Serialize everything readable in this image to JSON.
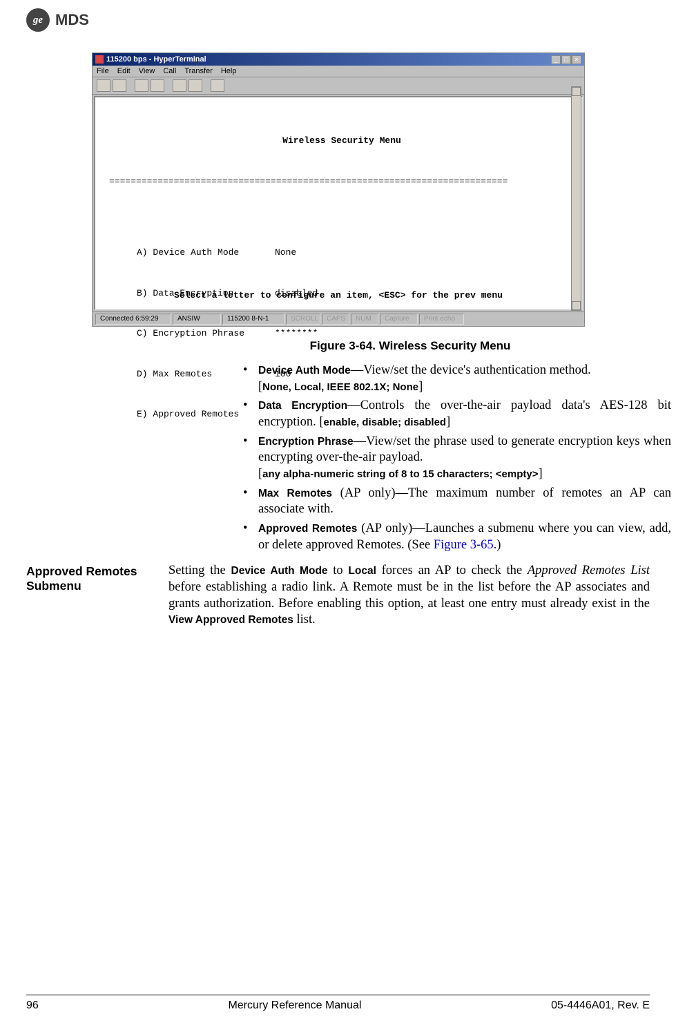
{
  "logo": {
    "ge": "ge",
    "mds": "MDS"
  },
  "screenshot": {
    "title": "115200 bps - HyperTerminal",
    "menubar": [
      "File",
      "Edit",
      "View",
      "Call",
      "Transfer",
      "Help"
    ],
    "terminal_title": "Wireless Security Menu",
    "items": [
      {
        "key": "A) Device Auth Mode",
        "val": "None"
      },
      {
        "key": "B) Data Encryption",
        "val": "disabled"
      },
      {
        "key": "C) Encryption Phrase",
        "val": "********"
      },
      {
        "key": "D) Max Remotes",
        "val": "100"
      },
      {
        "key": "E) Approved Remotes",
        "val": ""
      }
    ],
    "footer": "Select a letter to configure an item, <ESC> for the prev menu",
    "status": {
      "conn": "Connected 6:59:29",
      "term": "ANSIW",
      "baud": "115200 8-N-1",
      "fields": [
        "SCROLL",
        "CAPS",
        "NUM",
        "Capture",
        "Print echo"
      ]
    }
  },
  "caption": "Figure 3-64. Wireless Security Menu",
  "bullets": {
    "b1": {
      "label": "Device Auth Mode",
      "text": "—View/set the device's authentication method.",
      "opt": "None, Local, IEEE 802.1X; None"
    },
    "b2": {
      "label": "Data Encryption",
      "text1": "—Controls the over-the-air payload data's AES-128 bit encryption. [",
      "opt": "enable, disable; disabled",
      "text2": "]"
    },
    "b3": {
      "label": "Encryption Phrase",
      "text": "—View/set the phrase used to generate encryption keys when encrypting over-the-air payload.",
      "opt": "any alpha-numeric string of 8 to 15 characters; <empty>"
    },
    "b4": {
      "label": "Max Remotes",
      "suffix": " (AP only)—The maximum number of remotes an AP can associate with."
    },
    "b5": {
      "label": "Approved Remotes",
      "suffix": " (AP only)—Launches a submenu where you can view, add, or delete approved Remotes. (See ",
      "link": "Figure 3-65",
      "end": ".)"
    }
  },
  "side": {
    "heading": "Approved Remotes Submenu",
    "p1a": "Setting the ",
    "p1b": "Device Auth Mode",
    "p1c": " to ",
    "p1d": "Local",
    "p1e": " forces an AP to check the ",
    "p1f": "Approved Remotes List",
    "p1g": " before establishing a radio link. A Remote must be in the list before the AP associates and grants authorization. Before enabling this option, at least one entry must already exist in the ",
    "p1h": "View Approved Remotes",
    "p1i": " list."
  },
  "footer": {
    "page": "96",
    "title": "Mercury Reference Manual",
    "doc": "05-4446A01, Rev. E"
  }
}
